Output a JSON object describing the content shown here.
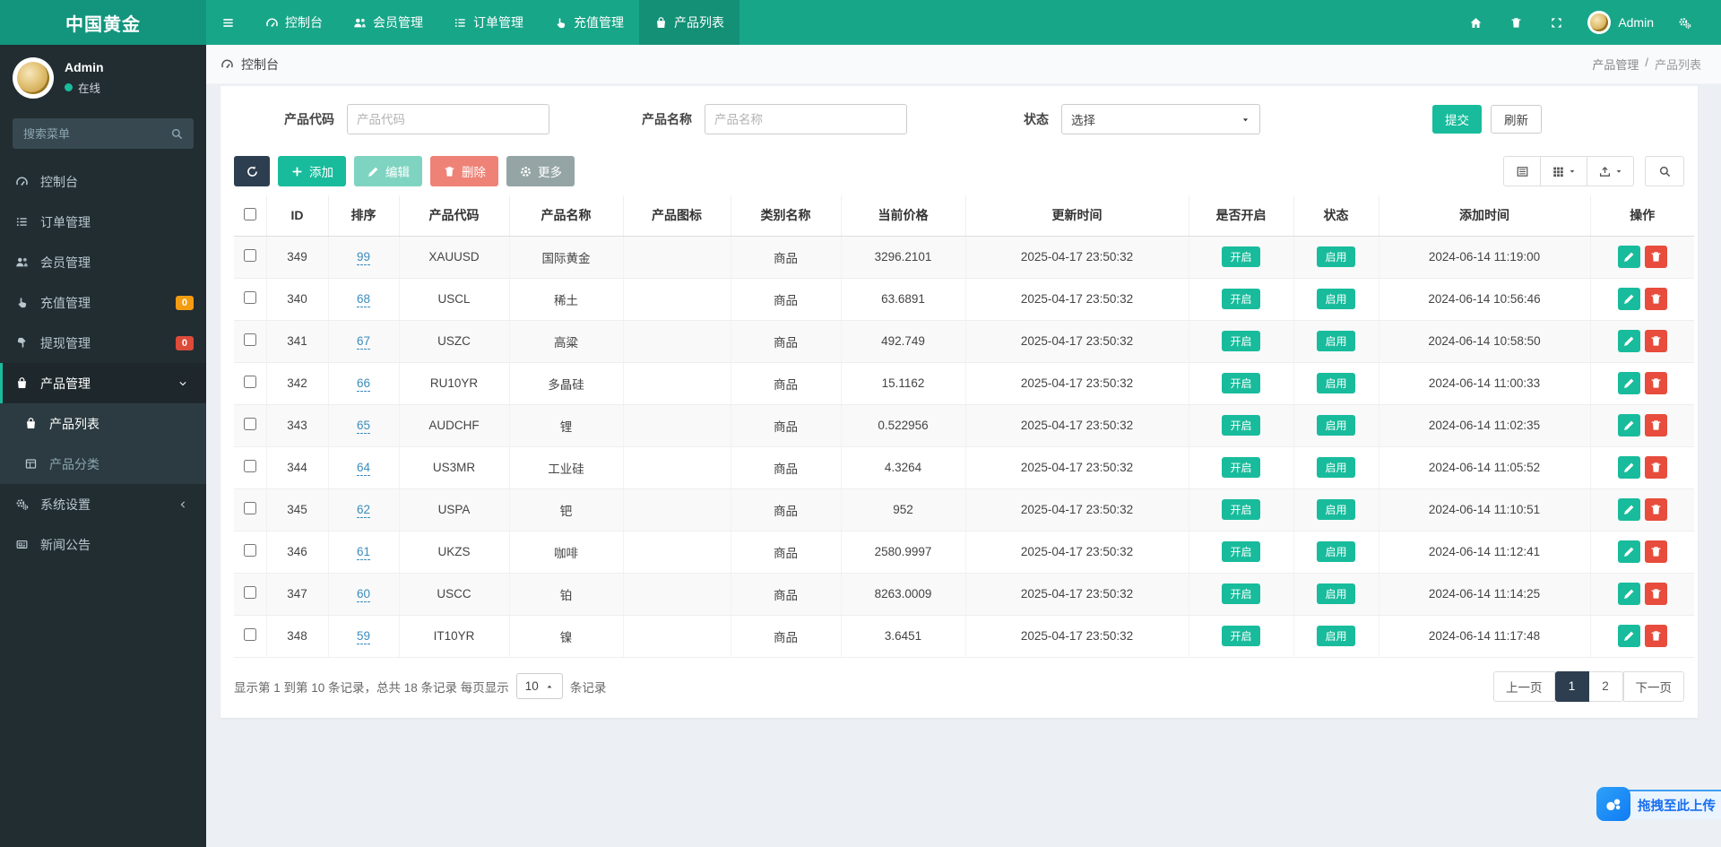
{
  "navbar": {
    "brand": "中国黄金",
    "items": [
      {
        "label": "控制台",
        "icon": "gauge",
        "active": false
      },
      {
        "label": "会员管理",
        "icon": "users",
        "active": false
      },
      {
        "label": "订单管理",
        "icon": "list",
        "active": false
      },
      {
        "label": "充值管理",
        "icon": "hand",
        "active": false
      },
      {
        "label": "产品列表",
        "icon": "bag",
        "active": true
      }
    ],
    "user_label": "Admin"
  },
  "sidebar": {
    "user": {
      "name": "Admin",
      "status": "在线"
    },
    "search_placeholder": "搜索菜单",
    "items": [
      {
        "label": "控制台",
        "icon": "gauge"
      },
      {
        "label": "订单管理",
        "icon": "list"
      },
      {
        "label": "会员管理",
        "icon": "users"
      },
      {
        "label": "充值管理",
        "icon": "hand",
        "badge": {
          "text": "0",
          "color": "#f39c12"
        }
      },
      {
        "label": "提现管理",
        "icon": "hand-down",
        "badge": {
          "text": "0",
          "color": "#dd4b39"
        }
      },
      {
        "label": "产品管理",
        "icon": "bag",
        "active": true,
        "chevron": "down",
        "children": [
          {
            "label": "产品列表",
            "icon": "bag",
            "active": true
          },
          {
            "label": "产品分类",
            "icon": "grid",
            "active": false
          }
        ]
      },
      {
        "label": "系统设置",
        "icon": "cogs",
        "chevron": "left"
      },
      {
        "label": "新闻公告",
        "icon": "news"
      }
    ]
  },
  "breadcrumb": {
    "title": "控制台",
    "right1": "产品管理",
    "sep": "/",
    "right2": "产品列表"
  },
  "filters": {
    "code": {
      "label": "产品代码",
      "placeholder": "产品代码",
      "value": ""
    },
    "name": {
      "label": "产品名称",
      "placeholder": "产品名称",
      "value": ""
    },
    "status": {
      "label": "状态",
      "value": "选择"
    },
    "submit_label": "提交",
    "refresh_label": "刷新"
  },
  "toolbar": {
    "add_label": "添加",
    "edit_label": "编辑",
    "delete_label": "删除",
    "more_label": "更多"
  },
  "table": {
    "headers": [
      "ID",
      "排序",
      "产品代码",
      "产品名称",
      "产品图标",
      "类别名称",
      "当前价格",
      "更新时间",
      "是否开启",
      "状态",
      "添加时间",
      "操作"
    ],
    "rows": [
      {
        "id": "349",
        "sort": "99",
        "code": "XAUUSD",
        "name": "国际黄金",
        "product_icon": "",
        "category": "商品",
        "price": "3296.2101",
        "updated": "2025-04-17 23:50:32",
        "enabled": "开启",
        "status": "启用",
        "added": "2024-06-14 11:19:00"
      },
      {
        "id": "340",
        "sort": "68",
        "code": "USCL",
        "name": "稀土",
        "product_icon": "",
        "category": "商品",
        "price": "63.6891",
        "updated": "2025-04-17 23:50:32",
        "enabled": "开启",
        "status": "启用",
        "added": "2024-06-14 10:56:46"
      },
      {
        "id": "341",
        "sort": "67",
        "code": "USZC",
        "name": "高粱",
        "product_icon": "",
        "category": "商品",
        "price": "492.749",
        "updated": "2025-04-17 23:50:32",
        "enabled": "开启",
        "status": "启用",
        "added": "2024-06-14 10:58:50"
      },
      {
        "id": "342",
        "sort": "66",
        "code": "RU10YR",
        "name": "多晶硅",
        "product_icon": "",
        "category": "商品",
        "price": "15.1162",
        "updated": "2025-04-17 23:50:32",
        "enabled": "开启",
        "status": "启用",
        "added": "2024-06-14 11:00:33"
      },
      {
        "id": "343",
        "sort": "65",
        "code": "AUDCHF",
        "name": "锂",
        "product_icon": "",
        "category": "商品",
        "price": "0.522956",
        "updated": "2025-04-17 23:50:32",
        "enabled": "开启",
        "status": "启用",
        "added": "2024-06-14 11:02:35"
      },
      {
        "id": "344",
        "sort": "64",
        "code": "US3MR",
        "name": "工业硅",
        "product_icon": "",
        "category": "商品",
        "price": "4.3264",
        "updated": "2025-04-17 23:50:32",
        "enabled": "开启",
        "status": "启用",
        "added": "2024-06-14 11:05:52"
      },
      {
        "id": "345",
        "sort": "62",
        "code": "USPA",
        "name": "钯",
        "product_icon": "",
        "category": "商品",
        "price": "952",
        "updated": "2025-04-17 23:50:32",
        "enabled": "开启",
        "status": "启用",
        "added": "2024-06-14 11:10:51"
      },
      {
        "id": "346",
        "sort": "61",
        "code": "UKZS",
        "name": "咖啡",
        "product_icon": "",
        "category": "商品",
        "price": "2580.9997",
        "updated": "2025-04-17 23:50:32",
        "enabled": "开启",
        "status": "启用",
        "added": "2024-06-14 11:12:41"
      },
      {
        "id": "347",
        "sort": "60",
        "code": "USCC",
        "name": "铂",
        "product_icon": "",
        "category": "商品",
        "price": "8263.0009",
        "updated": "2025-04-17 23:50:32",
        "enabled": "开启",
        "status": "启用",
        "added": "2024-06-14 11:14:25"
      },
      {
        "id": "348",
        "sort": "59",
        "code": "IT10YR",
        "name": "镍",
        "product_icon": "",
        "category": "商品",
        "price": "3.6451",
        "updated": "2025-04-17 23:50:32",
        "enabled": "开启",
        "status": "启用",
        "added": "2024-06-14 11:17:48"
      }
    ]
  },
  "pagination": {
    "info": "显示第 1 到第 10 条记录，总共 18 条记录 每页显示",
    "per_page": "10",
    "suffix": "条记录",
    "prev_label": "上一页",
    "next_label": "下一页",
    "pages": [
      "1",
      "2"
    ],
    "active_page": "1"
  },
  "upload": {
    "label": "拖拽至此上传"
  },
  "colors": {
    "navbar_green": "#18a689",
    "brand_green": "#12957c",
    "accent_teal": "#1abc9c",
    "dark_navy": "#2d3e50",
    "status_badge_green": "#18bc9c",
    "badge_orange": "#f39c12",
    "badge_red": "#dd4b39",
    "link_blue": "#3c8dbc",
    "upload_blue": "#176ef1",
    "content_bg": "#ecf0f5",
    "sidebar_bg": "#222d32"
  }
}
